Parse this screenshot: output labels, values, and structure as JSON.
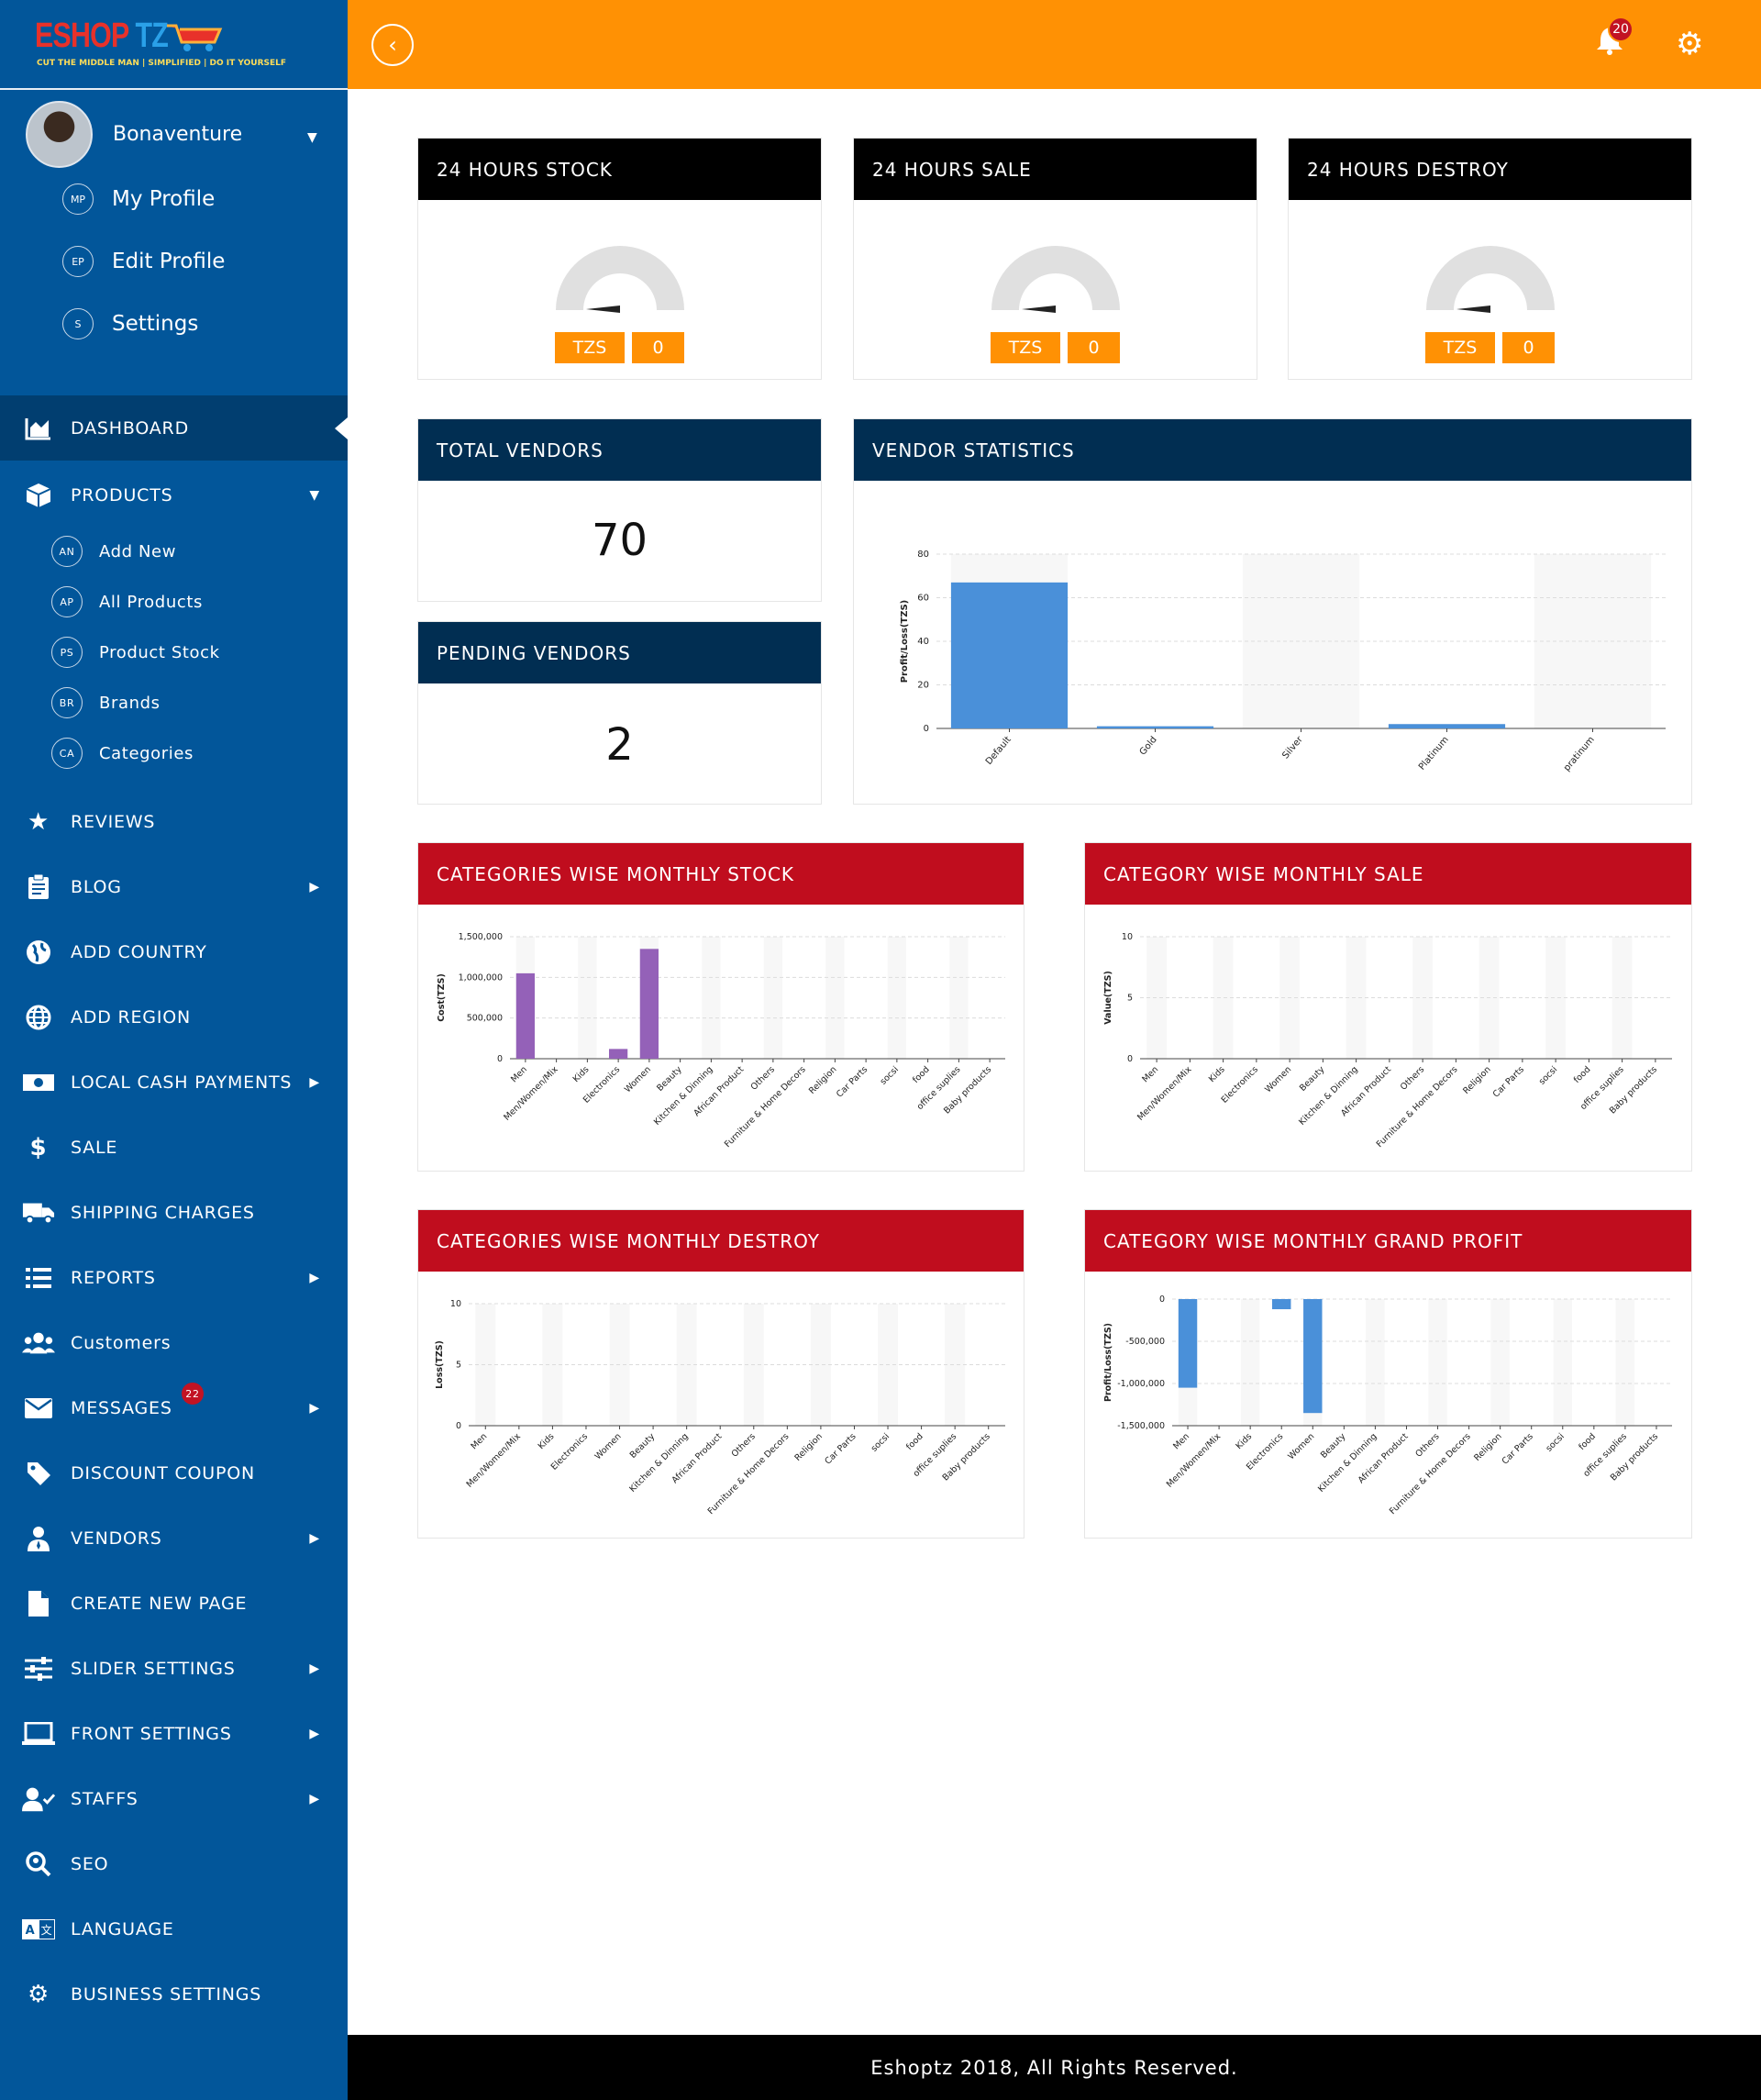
{
  "brand": {
    "logo_main": "ESHOP",
    "logo_tz": "TZ",
    "logo_sub": "CUT THE MIDDLE MAN | SIMPLIFIED | DO IT YOURSELF"
  },
  "user": {
    "name": "Bonaventure",
    "menu": [
      {
        "abbr": "MP",
        "label": "My Profile"
      },
      {
        "abbr": "EP",
        "label": "Edit Profile"
      },
      {
        "abbr": "S",
        "label": "Settings"
      }
    ]
  },
  "nav": {
    "dashboard": "DASHBOARD",
    "products": "PRODUCTS",
    "product_sub": [
      {
        "abbr": "AN",
        "label": "Add New"
      },
      {
        "abbr": "AP",
        "label": "All Products"
      },
      {
        "abbr": "PS",
        "label": "Product Stock"
      },
      {
        "abbr": "BR",
        "label": "Brands"
      },
      {
        "abbr": "CA",
        "label": "Categories"
      }
    ],
    "reviews": "REVIEWS",
    "blog": "BLOG",
    "add_country": "ADD COUNTRY",
    "add_region": "ADD REGION",
    "local_cash": "LOCAL CASH PAYMENTS",
    "sale": "SALE",
    "shipping": "SHIPPING CHARGES",
    "reports": "REPORTS",
    "customers": "Customers",
    "messages": "MESSAGES",
    "messages_badge": "22",
    "discount": "DISCOUNT COUPON",
    "vendors": "VENDORS",
    "create_page": "CREATE NEW PAGE",
    "slider": "SLIDER SETTINGS",
    "front": "FRONT SETTINGS",
    "staffs": "STAFFS",
    "seo": "SEO",
    "language": "LANGUAGE",
    "business": "BUSINESS SETTINGS"
  },
  "topbar": {
    "notifications": "20"
  },
  "cards": {
    "stock": {
      "title": "24 HOURS STOCK",
      "currency": "TZS",
      "value": "0",
      "gauge_level": 0
    },
    "sale": {
      "title": "24 HOURS SALE",
      "currency": "TZS",
      "value": "0",
      "gauge_level": 0
    },
    "destroy": {
      "title": "24 HOURS DESTROY",
      "currency": "TZS",
      "value": "0",
      "gauge_level": 0
    },
    "total_vendors": {
      "title": "TOTAL VENDORS",
      "value": "70"
    },
    "pending_vendors": {
      "title": "PENDING VENDORS",
      "value": "2"
    },
    "vendor_stats": {
      "title": "VENDOR STATISTICS"
    },
    "monthly_stock": {
      "title": "CATEGORIES WISE MONTHLY STOCK"
    },
    "monthly_sale": {
      "title": "CATEGORY WISE MONTHLY SALE"
    },
    "monthly_destroy": {
      "title": "CATEGORIES WISE MONTHLY DESTROY"
    },
    "monthly_profit": {
      "title": "CATEGORY WISE MONTHLY GRAND PROFIT"
    }
  },
  "colors": {
    "sidebar": "#02569a",
    "topbar": "#ff9104",
    "navy": "#012e52",
    "red": "#c00d1e",
    "blue_bar": "#4a90d9",
    "purple_bar": "#9461b8"
  },
  "footer": "Eshoptz 2018, All Rights Reserved.",
  "chart_data": [
    {
      "id": "vendor",
      "type": "bar",
      "categories": [
        "Default",
        "Gold",
        "Silver",
        "Platinum",
        "pratinum"
      ],
      "values": [
        67,
        1,
        0,
        2,
        0
      ],
      "ylabel": "Profit/Loss(TZS)",
      "yticks": [
        "0",
        "20",
        "40",
        "60",
        "80"
      ],
      "ylim": [
        0,
        80
      ]
    },
    {
      "id": "stock",
      "type": "bar",
      "categories": [
        "Men",
        "Men/Women/Mix",
        "Kids",
        "Electronics",
        "Women",
        "Beauty",
        "Kitchen & Dinning",
        "African Product",
        "Others",
        "Furniture & Home Decors",
        "Religion",
        "Car Parts",
        "socsi",
        "food",
        "office suplies",
        "Baby products"
      ],
      "values": [
        1050000,
        0,
        0,
        120000,
        1350000,
        0,
        0,
        0,
        0,
        0,
        0,
        0,
        0,
        0,
        0,
        0
      ],
      "ylabel": "Cost(TZS)",
      "yticks": [
        "0",
        "500,000",
        "1,000,000",
        "1,500,000"
      ],
      "ylim": [
        0,
        1500000
      ]
    },
    {
      "id": "sale",
      "type": "bar",
      "categories": [
        "Men",
        "Men/Women/Mix",
        "Kids",
        "Electronics",
        "Women",
        "Beauty",
        "Kitchen & Dinning",
        "African Product",
        "Others",
        "Furniture & Home Decors",
        "Religion",
        "Car Parts",
        "socsi",
        "food",
        "office suplies",
        "Baby products"
      ],
      "values": [
        0,
        0,
        0,
        0,
        0,
        0,
        0,
        0,
        0,
        0,
        0,
        0,
        0,
        0,
        0,
        0
      ],
      "ylabel": "Value(TZS)",
      "yticks": [
        "0",
        "5",
        "10"
      ],
      "ylim": [
        0,
        10
      ]
    },
    {
      "id": "destroy",
      "type": "bar",
      "categories": [
        "Men",
        "Men/Women/Mix",
        "Kids",
        "Electronics",
        "Women",
        "Beauty",
        "Kitchen & Dinning",
        "African Product",
        "Others",
        "Furniture & Home Decors",
        "Religion",
        "Car Parts",
        "socsi",
        "food",
        "office suplies",
        "Baby products"
      ],
      "values": [
        0,
        0,
        0,
        0,
        0,
        0,
        0,
        0,
        0,
        0,
        0,
        0,
        0,
        0,
        0,
        0
      ],
      "ylabel": "Loss(TZS)",
      "yticks": [
        "0",
        "5",
        "10"
      ],
      "ylim": [
        0,
        10
      ]
    },
    {
      "id": "profit",
      "type": "bar",
      "categories": [
        "Men",
        "Men/Women/Mix",
        "Kids",
        "Electronics",
        "Women",
        "Beauty",
        "Kitchen & Dinning",
        "African Product",
        "Others",
        "Furniture & Home Decors",
        "Religion",
        "Car Parts",
        "socsi",
        "food",
        "office suplies",
        "Baby products"
      ],
      "values": [
        -1050000,
        0,
        0,
        -120000,
        -1350000,
        0,
        0,
        0,
        0,
        0,
        0,
        0,
        0,
        0,
        0,
        0
      ],
      "ylabel": "Profit/Loss(TZS)",
      "yticks": [
        "-1,500,000",
        "-1,000,000",
        "-500,000",
        "0"
      ],
      "ylim": [
        -1500000,
        0
      ]
    }
  ]
}
